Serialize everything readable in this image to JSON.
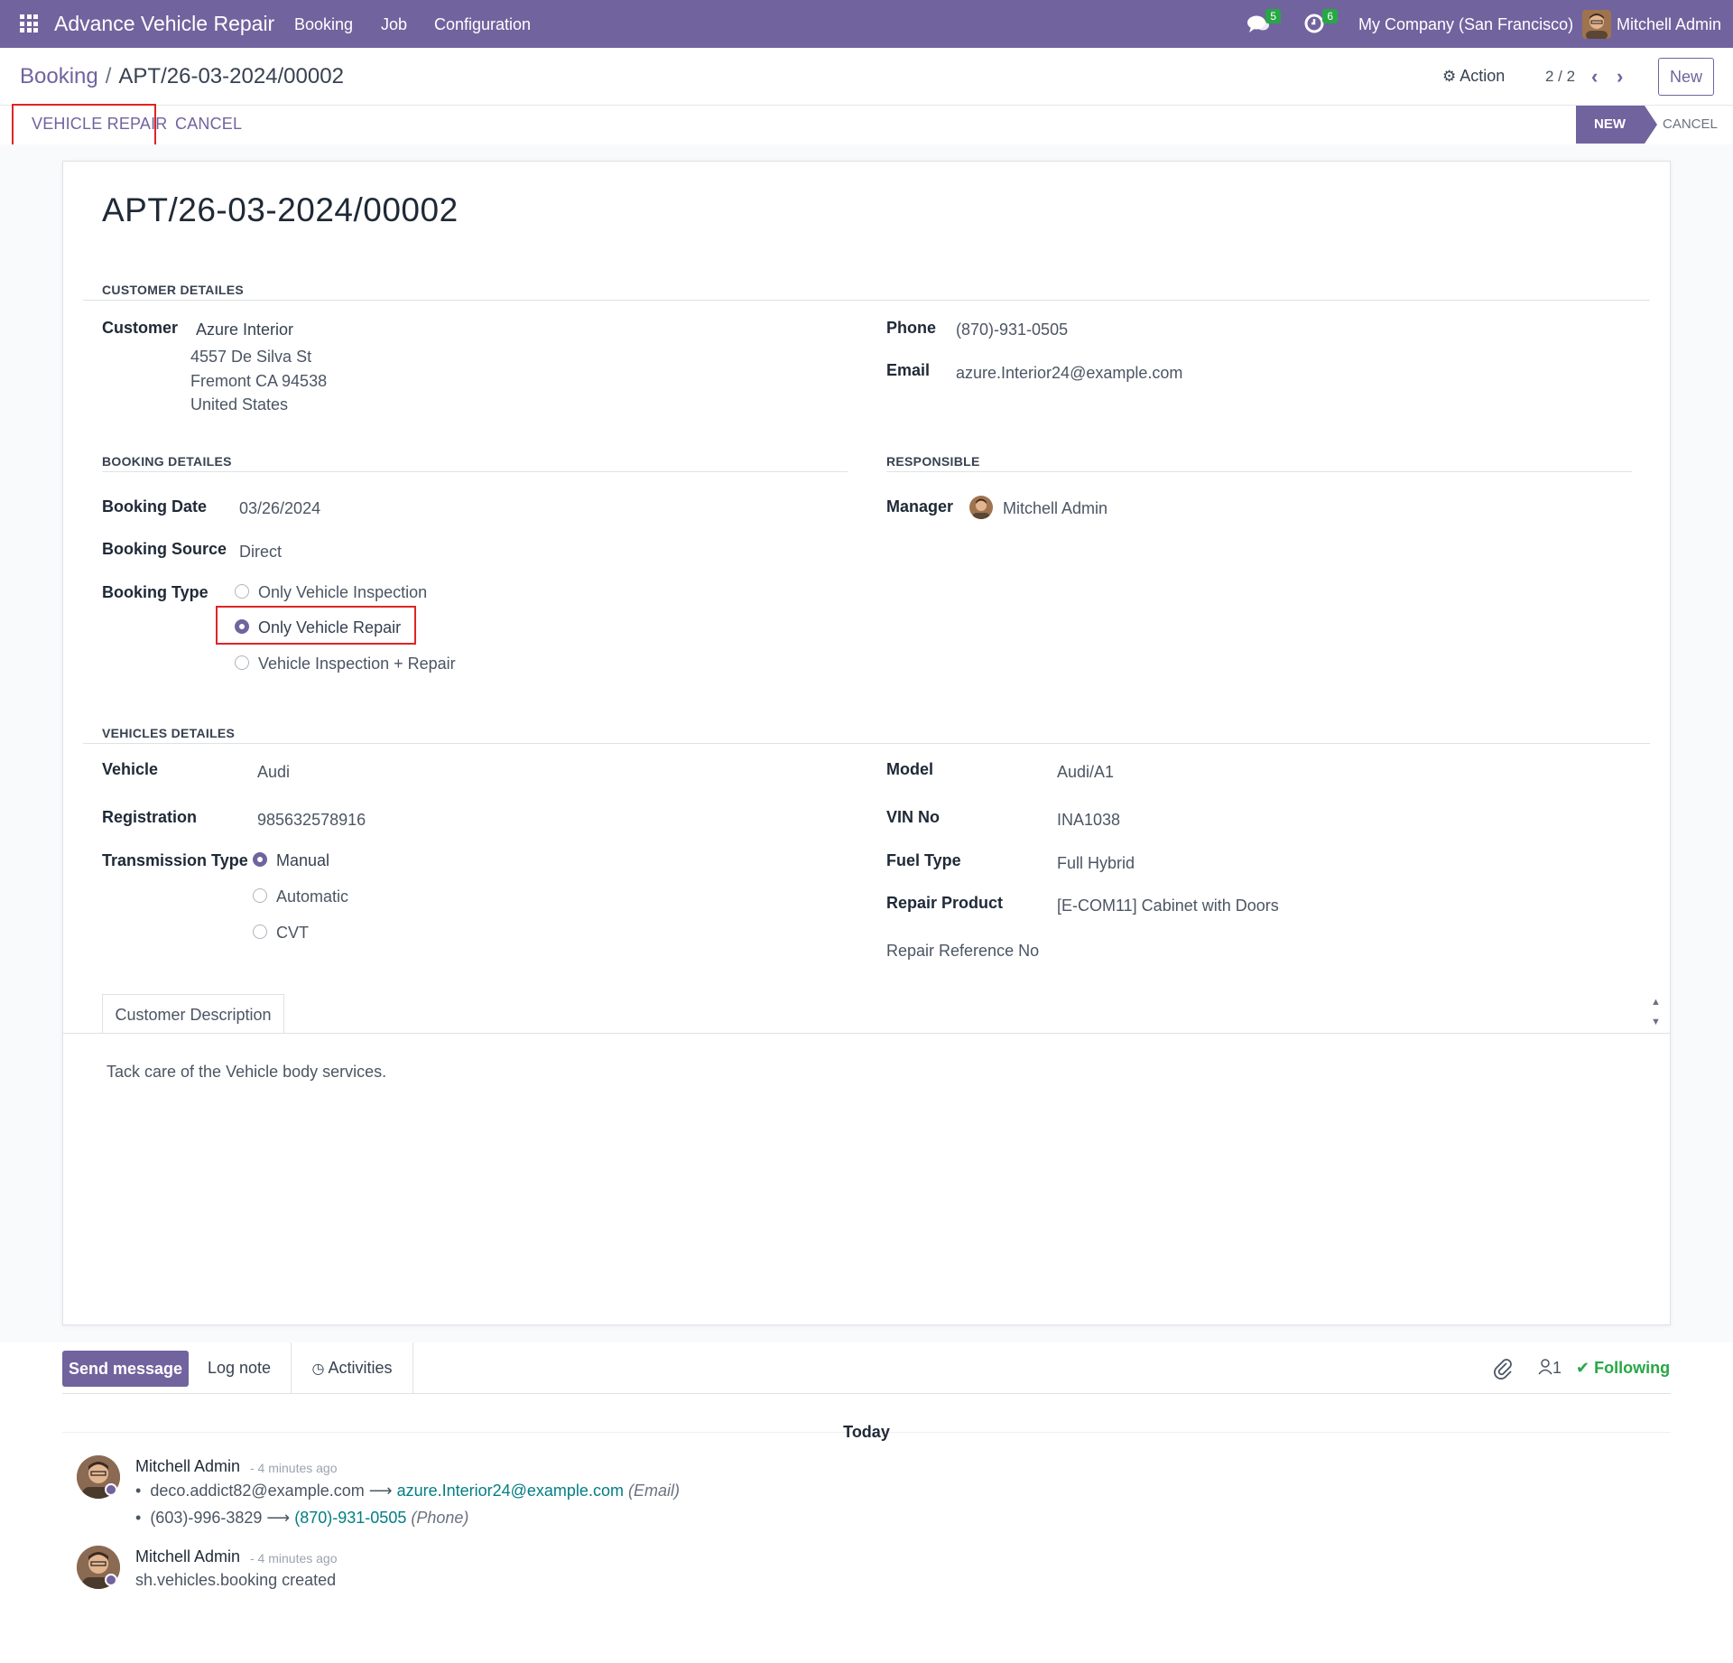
{
  "navbar": {
    "app_name": "Advance Vehicle Repair",
    "menu": [
      "Booking",
      "Job",
      "Configuration"
    ],
    "messages_count": "5",
    "activities_count": "6",
    "company": "My Company (San Francisco)",
    "user": "Mitchell Admin"
  },
  "control": {
    "breadcrumb_parent": "Booking",
    "breadcrumb_sep": "/",
    "breadcrumb_current": "APT/26-03-2024/00002",
    "action_label": "Action",
    "pager": "2 / 2",
    "new_label": "New"
  },
  "header": {
    "vehicle_repair_label": "VEHICLE REPAIR",
    "cancel_label": "CANCEL",
    "status_new": "NEW",
    "status_cancel": "CANCEL"
  },
  "record": {
    "title": "APT/26-03-2024/00002",
    "customer_section": "CUSTOMER DETAILES",
    "customer_label": "Customer",
    "customer_name": "Azure Interior",
    "customer_addr1": "4557 De Silva St",
    "customer_addr2": "Fremont CA 94538",
    "customer_addr3": "United States",
    "phone_label": "Phone",
    "phone": "(870)-931-0505",
    "email_label": "Email",
    "email": "azure.Interior24@example.com",
    "booking_section": "BOOKING DETAILES",
    "booking_date_label": "Booking Date",
    "booking_date": "03/26/2024",
    "booking_source_label": "Booking Source",
    "booking_source": "Direct",
    "booking_type_label": "Booking Type",
    "booking_types": [
      "Only Vehicle Inspection",
      "Only Vehicle Repair",
      "Vehicle Inspection + Repair"
    ],
    "booking_type_selected": "Only Vehicle Repair",
    "responsible_section": "RESPONSIBLE",
    "manager_label": "Manager",
    "manager": "Mitchell Admin",
    "vehicles_section": "VEHICLES DETAILES",
    "vehicle_label": "Vehicle",
    "vehicle": "Audi",
    "registration_label": "Registration",
    "registration": "985632578916",
    "transmission_label": "Transmission Type",
    "transmissions": [
      "Manual",
      "Automatic",
      "CVT"
    ],
    "transmission_selected": "Manual",
    "model_label": "Model",
    "model": "Audi/A1",
    "vin_label": "VIN No",
    "vin": "INA1038",
    "fuel_label": "Fuel Type",
    "fuel": "Full Hybrid",
    "repair_product_label": "Repair Product",
    "repair_product": "[E-COM11] Cabinet with Doors",
    "repair_ref_label": "Repair Reference No",
    "tab_label": "Customer Description",
    "description": "Tack care of the Vehicle body services."
  },
  "chatter": {
    "send_message": "Send message",
    "log_note": "Log note",
    "activities": "Activities",
    "followers_count": "1",
    "following": "Following",
    "today": "Today",
    "messages": [
      {
        "author": "Mitchell Admin",
        "ago": "- 4 minutes ago",
        "changes": [
          {
            "old": "deco.addict82@example.com",
            "new": "azure.Interior24@example.com",
            "field": "(Email)"
          },
          {
            "old": "(603)-996-3829",
            "new": "(870)-931-0505",
            "field": "(Phone)"
          }
        ]
      },
      {
        "author": "Mitchell Admin",
        "ago": "- 4 minutes ago",
        "body": "sh.vehicles.booking created"
      }
    ]
  },
  "colors": {
    "brand": "#71639e",
    "highlight": "#e02424",
    "success": "#28a745",
    "link": "#017e84"
  }
}
